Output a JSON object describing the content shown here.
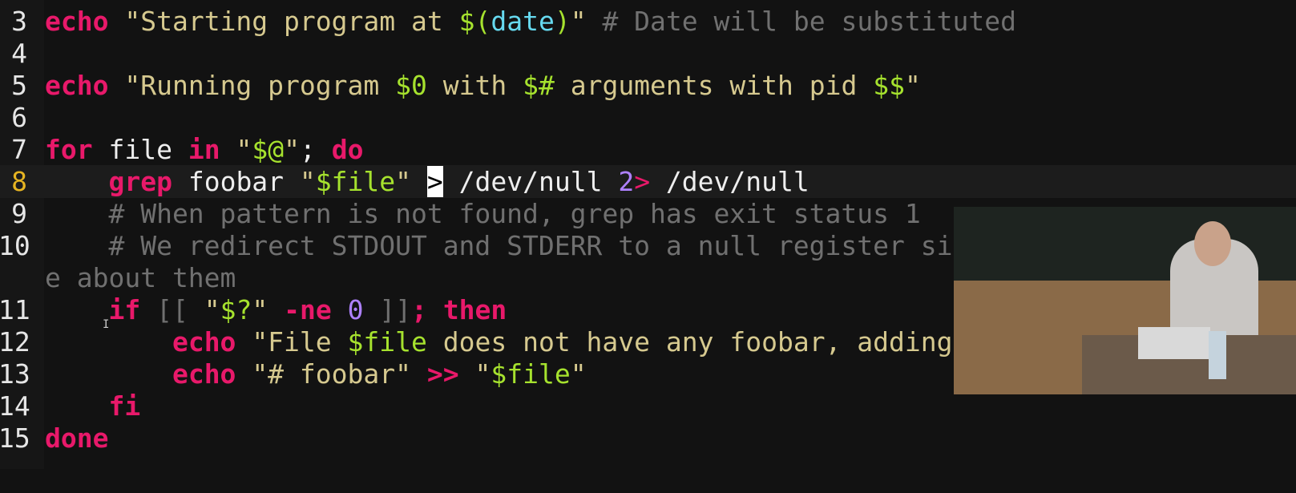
{
  "editor": {
    "current_line": 8,
    "lines": [
      {
        "number": "3",
        "tokens": [
          {
            "t": "echo",
            "c": "kw"
          },
          {
            "t": " ",
            "c": "plain"
          },
          {
            "t": "\"Starting program at ",
            "c": "str"
          },
          {
            "t": "$(",
            "c": "var"
          },
          {
            "t": "date",
            "c": "sub"
          },
          {
            "t": ")",
            "c": "var"
          },
          {
            "t": "\"",
            "c": "str"
          },
          {
            "t": " # Date will be substituted",
            "c": "cmt"
          }
        ]
      },
      {
        "number": "4",
        "tokens": []
      },
      {
        "number": "5",
        "tokens": [
          {
            "t": "echo",
            "c": "kw"
          },
          {
            "t": " ",
            "c": "plain"
          },
          {
            "t": "\"Running program ",
            "c": "str"
          },
          {
            "t": "$0",
            "c": "var"
          },
          {
            "t": " with ",
            "c": "str"
          },
          {
            "t": "$#",
            "c": "var"
          },
          {
            "t": " arguments with pid ",
            "c": "str"
          },
          {
            "t": "$$",
            "c": "var"
          },
          {
            "t": "\"",
            "c": "str"
          }
        ]
      },
      {
        "number": "6",
        "tokens": []
      },
      {
        "number": "7",
        "tokens": [
          {
            "t": "for",
            "c": "kw"
          },
          {
            "t": " file ",
            "c": "plain"
          },
          {
            "t": "in",
            "c": "kw"
          },
          {
            "t": " \"",
            "c": "str"
          },
          {
            "t": "$@",
            "c": "var"
          },
          {
            "t": "\"",
            "c": "str"
          },
          {
            "t": "; ",
            "c": "plain"
          },
          {
            "t": "do",
            "c": "kw"
          }
        ]
      },
      {
        "number": "8",
        "tokens": [
          {
            "t": "    ",
            "c": "plain"
          },
          {
            "t": "grep",
            "c": "kw"
          },
          {
            "t": " foobar ",
            "c": "plain"
          },
          {
            "t": "\"",
            "c": "str"
          },
          {
            "t": "$file",
            "c": "var"
          },
          {
            "t": "\"",
            "c": "str"
          },
          {
            "t": " ",
            "c": "plain"
          },
          {
            "t": ">",
            "c": "cursor"
          },
          {
            "t": " /dev/null ",
            "c": "plain"
          },
          {
            "t": "2",
            "c": "num"
          },
          {
            "t": ">",
            "c": "redir"
          },
          {
            "t": " /dev/null",
            "c": "plain"
          }
        ]
      },
      {
        "number": "9",
        "tokens": [
          {
            "t": "    # When pattern is not found, grep has exit status 1",
            "c": "cmt"
          }
        ]
      },
      {
        "number": "10",
        "tokens": [
          {
            "t": "    # We redirect STDOUT and STDERR to a null register since we do not car",
            "c": "cmt"
          }
        ]
      },
      {
        "number": "",
        "tokens": [
          {
            "t": "e about them",
            "c": "cmt"
          }
        ]
      },
      {
        "number": "11",
        "tokens": [
          {
            "t": "    ",
            "c": "plain"
          },
          {
            "t": "if",
            "c": "kw"
          },
          {
            "t": " [[ ",
            "c": "cmt"
          },
          {
            "t": "\"",
            "c": "str"
          },
          {
            "t": "$?",
            "c": "var"
          },
          {
            "t": "\"",
            "c": "str"
          },
          {
            "t": " ",
            "c": "plain"
          },
          {
            "t": "-ne",
            "c": "kw"
          },
          {
            "t": " ",
            "c": "plain"
          },
          {
            "t": "0",
            "c": "num"
          },
          {
            "t": " ]]",
            "c": "cmt"
          },
          {
            "t": "; ",
            "c": "kw"
          },
          {
            "t": "then",
            "c": "kw"
          }
        ]
      },
      {
        "number": "12",
        "tokens": [
          {
            "t": "        ",
            "c": "plain"
          },
          {
            "t": "echo",
            "c": "kw"
          },
          {
            "t": " ",
            "c": "plain"
          },
          {
            "t": "\"File ",
            "c": "str"
          },
          {
            "t": "$file",
            "c": "var"
          },
          {
            "t": " does not have any foobar, adding one\"",
            "c": "str"
          }
        ]
      },
      {
        "number": "13",
        "tokens": [
          {
            "t": "        ",
            "c": "plain"
          },
          {
            "t": "echo",
            "c": "kw"
          },
          {
            "t": " ",
            "c": "plain"
          },
          {
            "t": "\"# foobar\"",
            "c": "str"
          },
          {
            "t": " ",
            "c": "plain"
          },
          {
            "t": ">>",
            "c": "kw"
          },
          {
            "t": " ",
            "c": "plain"
          },
          {
            "t": "\"",
            "c": "str"
          },
          {
            "t": "$file",
            "c": "var"
          },
          {
            "t": "\"",
            "c": "str"
          }
        ]
      },
      {
        "number": "14",
        "tokens": [
          {
            "t": "    ",
            "c": "plain"
          },
          {
            "t": "fi",
            "c": "kw"
          }
        ]
      },
      {
        "number": "15",
        "tokens": [
          {
            "t": "done",
            "c": "kw"
          }
        ]
      }
    ]
  },
  "colors": {
    "background": "#121212",
    "keyword": "#e8196a",
    "string": "#d6c98f",
    "variable": "#a6e22e",
    "substitution": "#66d9ef",
    "number": "#ae81ff",
    "comment": "#707070",
    "current_line_number": "#e6b422"
  },
  "overlay": {
    "type": "webcam-video"
  }
}
